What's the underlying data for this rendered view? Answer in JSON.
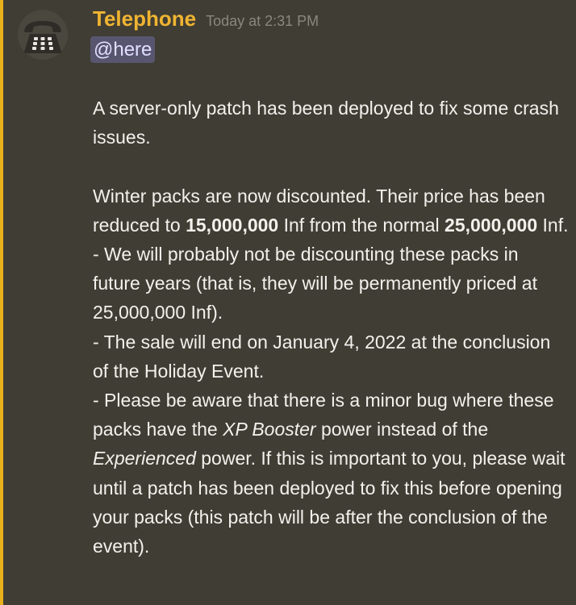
{
  "message": {
    "author": "Telephone",
    "timestamp": "Today at 2:31 PM",
    "mention": "@here",
    "avatar_icon": "telephone-icon",
    "accent_color": "#e9b21c",
    "author_color": "#f0b432",
    "p1": "A server-only patch has been deployed to fix some crash issues.",
    "p2_a": "Winter packs are now discounted. Their price has been reduced to ",
    "p2_bold1": "15,000,000",
    "p2_b": " Inf from the normal ",
    "p2_bold2": "25,000,000",
    "p2_c": " Inf.",
    "p3": "- We will probably not be discounting these packs in future years (that is, they will be permanently priced at 25,000,000 Inf).",
    "p4": "- The sale will end on January 4, 2022 at the conclusion of the Holiday Event.",
    "p5_a": "- Please be aware that there is a minor bug where these packs have the ",
    "p5_italic1": "XP Booster",
    "p5_b": " power instead of the ",
    "p5_italic2": "Experienced",
    "p5_c": " power. If this is important to you, please wait until a patch has been deployed to fix this before opening your packs (this patch will be after the conclusion of the event)."
  }
}
